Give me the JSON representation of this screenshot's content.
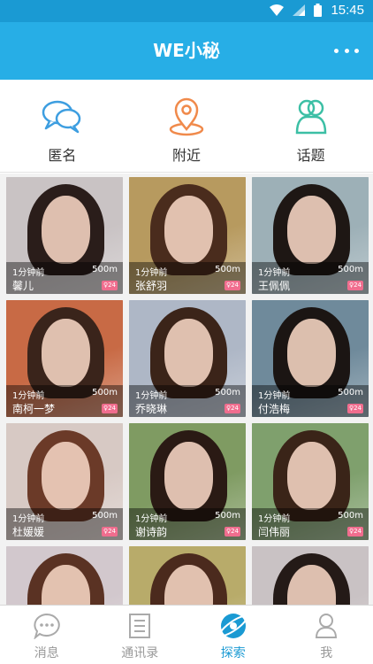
{
  "status_bar": {
    "time": "15:45",
    "icons": [
      "wifi-icon",
      "signal-icon",
      "battery-icon"
    ]
  },
  "app_bar": {
    "title": "WE小秘",
    "menu_icon": "more-dots-icon"
  },
  "quick_nav": [
    {
      "label": "匿名",
      "icon": "chat-bubbles-icon",
      "color": "#3d9ee0"
    },
    {
      "label": "附近",
      "icon": "location-pin-icon",
      "color": "#f08a4b"
    },
    {
      "label": "话题",
      "icon": "topic-people-icon",
      "color": "#3cbfa5"
    }
  ],
  "profiles": [
    {
      "time": "1分钟前",
      "distance": "500m",
      "name": "馨儿",
      "badge": "♀24",
      "bg": "#c9c3c4",
      "hair": "#2a1d1a"
    },
    {
      "time": "1分钟前",
      "distance": "500m",
      "name": "张舒羽",
      "badge": "♀24",
      "bg": "#b79a5f",
      "hair": "#4a2c1d"
    },
    {
      "time": "1分钟前",
      "distance": "500m",
      "name": "王佩佩",
      "badge": "♀24",
      "bg": "#9db0b7",
      "hair": "#1e1714"
    },
    {
      "time": "1分钟前",
      "distance": "500m",
      "name": "南柯一梦",
      "badge": "♀24",
      "bg": "#c86a45",
      "hair": "#3a241b"
    },
    {
      "time": "1分钟前",
      "distance": "500m",
      "name": "乔晓琳",
      "badge": "♀24",
      "bg": "#aeb7c6",
      "hair": "#3b2419"
    },
    {
      "time": "1分钟前",
      "distance": "500m",
      "name": "付浩梅",
      "badge": "♀24",
      "bg": "#6f8a9b",
      "hair": "#1b1513"
    },
    {
      "time": "1分钟前",
      "distance": "500m",
      "name": "杜媛媛",
      "badge": "♀24",
      "bg": "#d7c9c4",
      "hair": "#6b3a28"
    },
    {
      "time": "1分钟前",
      "distance": "500m",
      "name": "谢诗韵",
      "badge": "♀24",
      "bg": "#7f9b62",
      "hair": "#2a1a14"
    },
    {
      "time": "1分钟前",
      "distance": "500m",
      "name": "闫伟丽",
      "badge": "♀24",
      "bg": "#7fa06d",
      "hair": "#3a2418"
    },
    {
      "time": "",
      "distance": "",
      "name": "",
      "badge": "",
      "bg": "#d2c8cd",
      "hair": "#5a3223"
    },
    {
      "time": "",
      "distance": "",
      "name": "",
      "badge": "",
      "bg": "#b8ab6a",
      "hair": "#4b2a1d"
    },
    {
      "time": "",
      "distance": "",
      "name": "",
      "badge": "",
      "bg": "#c9c2c4",
      "hair": "#241a17"
    }
  ],
  "tab_bar": [
    {
      "label": "消息",
      "icon": "message-icon",
      "active": false
    },
    {
      "label": "通讯录",
      "icon": "contacts-icon",
      "active": false
    },
    {
      "label": "探索",
      "icon": "explore-planet-icon",
      "active": true
    },
    {
      "label": "我",
      "icon": "profile-person-icon",
      "active": false
    }
  ],
  "colors": {
    "primary": "#27aee6",
    "status_bar": "#1a9ad3",
    "badge": "#f06d8e",
    "tab_inactive": "#999999"
  }
}
